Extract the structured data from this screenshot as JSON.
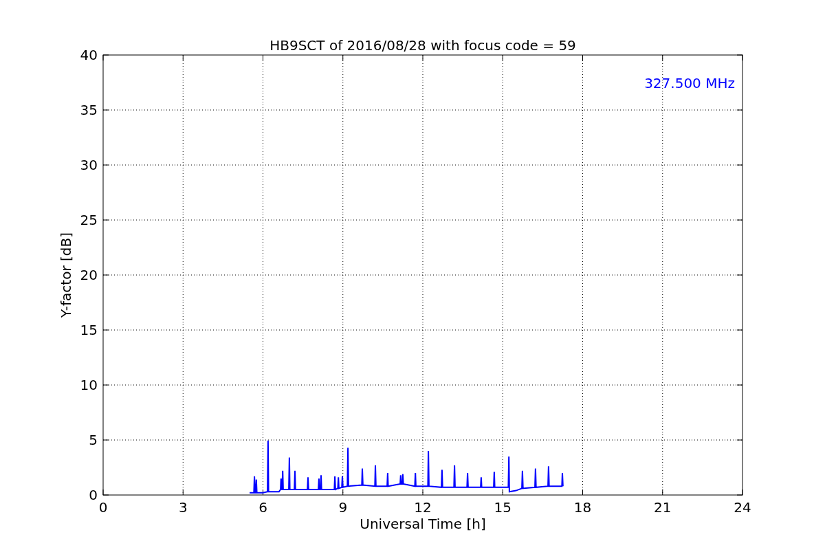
{
  "figure": {
    "chart_data": {
      "type": "line",
      "title": "HB9SCT of 2016/08/28 with focus code = 59",
      "xlabel": "Universal Time [h]",
      "ylabel": "Y-factor [dB]",
      "xlim": [
        0,
        24
      ],
      "ylim": [
        0,
        40
      ],
      "xticks": [
        0,
        3,
        6,
        9,
        12,
        15,
        18,
        21,
        24
      ],
      "yticks": [
        0,
        5,
        10,
        15,
        20,
        25,
        30,
        35,
        40
      ],
      "x": [
        5.5,
        5.66,
        5.68,
        5.7,
        5.73,
        5.75,
        5.77,
        6.0,
        6.17,
        6.19,
        6.21,
        6.5,
        6.6,
        6.66,
        6.68,
        6.7,
        6.72,
        6.74,
        6.76,
        6.97,
        6.99,
        7.01,
        7.18,
        7.2,
        7.22,
        7.67,
        7.69,
        7.71,
        8.08,
        8.1,
        8.12,
        8.16,
        8.18,
        8.2,
        8.68,
        8.7,
        8.72,
        8.81,
        8.83,
        8.85,
        8.96,
        8.98,
        9.0,
        9.17,
        9.19,
        9.21,
        9.71,
        9.73,
        9.75,
        10.2,
        10.22,
        10.24,
        10.66,
        10.68,
        10.7,
        11.15,
        11.17,
        11.19,
        11.23,
        11.25,
        11.27,
        11.7,
        11.72,
        11.74,
        12.19,
        12.21,
        12.23,
        12.7,
        12.72,
        12.74,
        13.17,
        13.19,
        13.21,
        13.66,
        13.68,
        13.7,
        14.17,
        14.19,
        14.21,
        14.66,
        14.68,
        14.7,
        15.21,
        15.23,
        15.25,
        15.5,
        15.72,
        15.74,
        15.76,
        16.21,
        16.23,
        16.25,
        16.7,
        16.72,
        16.74,
        17.22,
        17.24,
        17.26
      ],
      "series": [
        {
          "name": "327.500 MHz",
          "color": "#0000ff",
          "values": [
            0.2,
            0.2,
            1.7,
            0.2,
            0.2,
            1.4,
            0.2,
            0.2,
            0.3,
            4.95,
            0.3,
            0.3,
            0.3,
            0.5,
            1.5,
            0.5,
            0.5,
            2.2,
            0.5,
            0.5,
            3.4,
            0.5,
            0.5,
            2.2,
            0.5,
            0.5,
            1.6,
            0.5,
            0.5,
            1.5,
            0.5,
            0.5,
            1.8,
            0.5,
            0.5,
            1.7,
            0.5,
            0.6,
            1.6,
            0.6,
            0.7,
            1.7,
            0.7,
            0.8,
            4.3,
            0.8,
            0.9,
            2.4,
            0.9,
            0.8,
            2.7,
            0.8,
            0.8,
            2.0,
            0.8,
            1.0,
            1.8,
            1.0,
            1.0,
            1.9,
            1.0,
            0.8,
            2.0,
            0.8,
            0.8,
            4.0,
            0.8,
            0.7,
            2.3,
            0.7,
            0.7,
            2.7,
            0.7,
            0.7,
            2.0,
            0.7,
            0.7,
            1.6,
            0.7,
            0.7,
            2.1,
            0.7,
            0.7,
            3.5,
            0.3,
            0.4,
            0.6,
            2.2,
            0.6,
            0.7,
            2.4,
            0.7,
            0.8,
            2.6,
            0.8,
            0.8,
            2.0,
            0.8
          ]
        }
      ],
      "grid": true
    }
  }
}
